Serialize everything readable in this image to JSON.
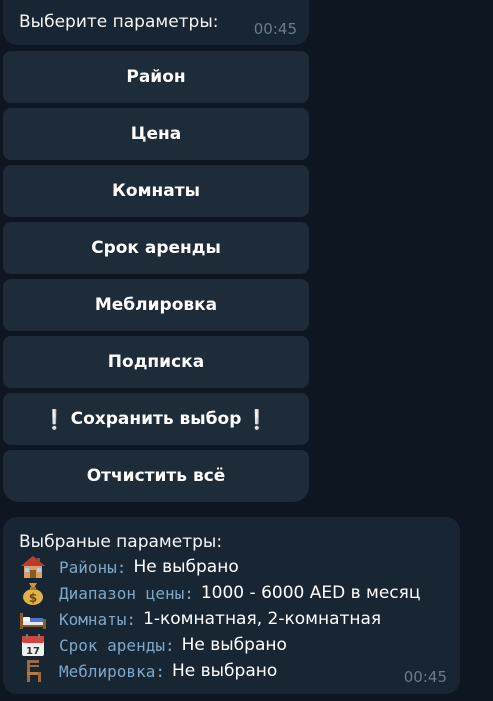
{
  "message_1": {
    "text": "Выберите параметры:",
    "time": "00:45"
  },
  "keyboard": {
    "buttons": [
      {
        "label": "Район"
      },
      {
        "label": "Цена"
      },
      {
        "label": "Комнаты"
      },
      {
        "label": "Срок аренды"
      },
      {
        "label": "Меблировка"
      },
      {
        "label": "Подписка"
      },
      {
        "label": "Сохранить выбор",
        "emoji_left": "❕",
        "emoji_right": "❕"
      },
      {
        "label": "Отчистить всё"
      }
    ]
  },
  "message_2": {
    "title": "Выбраные параметры:",
    "time": "00:45",
    "rows": [
      {
        "icon": "house-icon",
        "key": "Районы:",
        "value": "Не выбрано"
      },
      {
        "icon": "money-bag-icon",
        "key": "Диапазон цены:",
        "value": "1000 - 6000 AED в месяц"
      },
      {
        "icon": "bed-icon",
        "key": "Комнаты:",
        "value": "1-комнатная, 2-комнатная"
      },
      {
        "icon": "calendar-icon",
        "key": "Срок аренды:",
        "value": "Не выбрано"
      },
      {
        "icon": "chair-icon",
        "key": "Меблировка:",
        "value": "Не выбрано"
      }
    ],
    "calendar_day": "17"
  },
  "colors": {
    "background": "#0e1621",
    "bubble": "#182533",
    "button": "#1e2c3a",
    "key_text": "#7fa8c7",
    "time_text": "#6b7b8c"
  }
}
